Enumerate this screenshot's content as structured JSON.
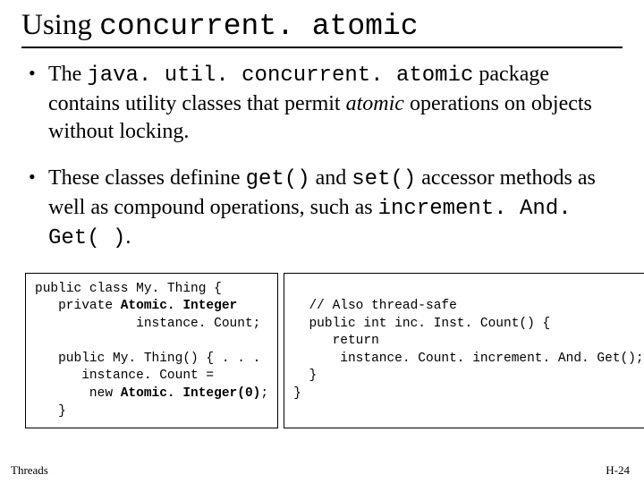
{
  "title": {
    "prefix": "Using ",
    "mono": "concurrent. atomic"
  },
  "bullets": [
    {
      "runs": [
        {
          "t": "The ",
          "cls": ""
        },
        {
          "t": "java. util. concurrent. atomic",
          "cls": "mono"
        },
        {
          "t": " package contains utility classes that permit ",
          "cls": ""
        },
        {
          "t": "atomic",
          "cls": "italic"
        },
        {
          "t": " operations on objects without locking.",
          "cls": ""
        }
      ]
    },
    {
      "runs": [
        {
          "t": "These classes definine ",
          "cls": ""
        },
        {
          "t": "get()",
          "cls": "mono"
        },
        {
          "t": " and ",
          "cls": ""
        },
        {
          "t": "set()",
          "cls": "mono"
        },
        {
          "t": " accessor methods as well as compound operations, such as ",
          "cls": ""
        },
        {
          "t": "increment. And. Get( )",
          "cls": "mono"
        },
        {
          "t": ".",
          "cls": ""
        }
      ]
    }
  ],
  "code_left": {
    "l1": "public class My. Thing {",
    "l2a": "   private ",
    "l2b": "Atomic. Integer",
    "l3": "             instance. Count;",
    "l4": "",
    "l5": "   public My. Thing() { . . .",
    "l6": "      instance. Count =",
    "l7a": "       new ",
    "l7b": "Atomic. Integer(0)",
    "l7c": ";",
    "l8": "   }"
  },
  "code_right": {
    "l1": "",
    "l2": "  // Also thread-safe",
    "l3": "  public int inc. Inst. Count() {",
    "l4": "     return",
    "l5": "      instance. Count. increment. And. Get();",
    "l6": "  }",
    "l7": "}"
  },
  "footer": {
    "left": "Threads",
    "right": "H-24"
  }
}
